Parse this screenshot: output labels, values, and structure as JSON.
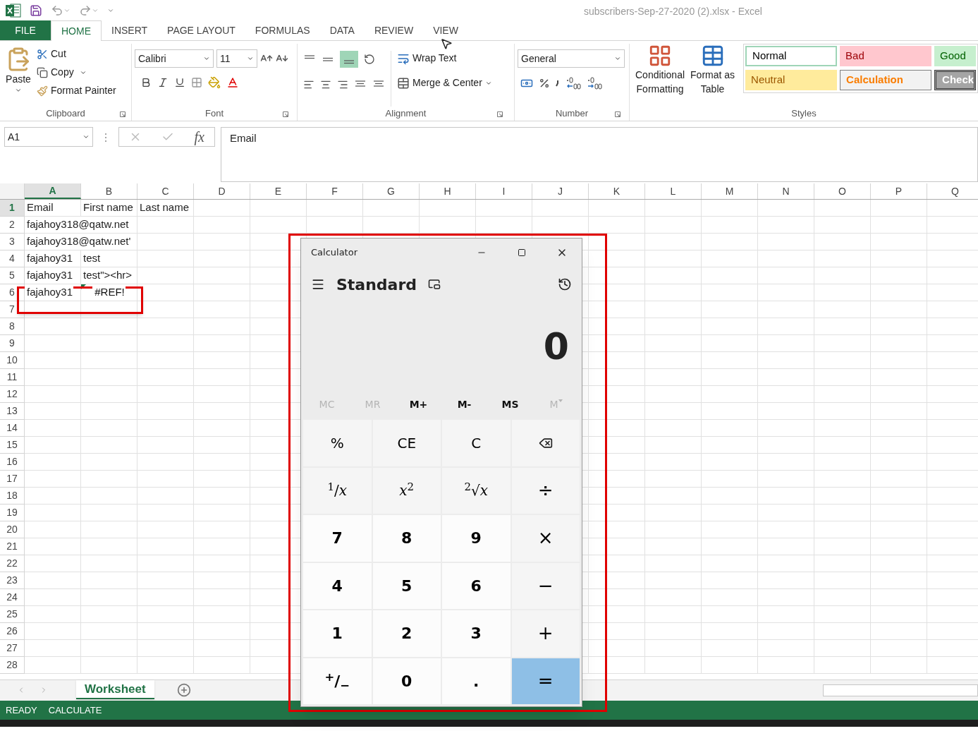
{
  "title_bar": {
    "title": "subscribers-Sep-27-2020 (2).xlsx - Excel"
  },
  "ribbon_tabs": [
    {
      "label": "FILE",
      "kind": "file",
      "selected": false
    },
    {
      "label": "HOME",
      "kind": "tab",
      "selected": true
    },
    {
      "label": "INSERT",
      "kind": "tab",
      "selected": false
    },
    {
      "label": "PAGE LAYOUT",
      "kind": "tab",
      "selected": false
    },
    {
      "label": "FORMULAS",
      "kind": "tab",
      "selected": false
    },
    {
      "label": "DATA",
      "kind": "tab",
      "selected": false
    },
    {
      "label": "REVIEW",
      "kind": "tab",
      "selected": false
    },
    {
      "label": "VIEW",
      "kind": "tab",
      "selected": false
    }
  ],
  "clipboard": {
    "paste": "Paste",
    "cut": "Cut",
    "copy": "Copy",
    "format_painter": "Format Painter",
    "label": "Clipboard"
  },
  "font": {
    "name": "Calibri",
    "size": "11",
    "label": "Font"
  },
  "alignment": {
    "wrap_text": "Wrap Text",
    "merge": "Merge & Center",
    "label": "Alignment"
  },
  "number": {
    "format": "General",
    "label": "Number"
  },
  "styles": {
    "conditional": [
      "Conditional",
      "Formatting"
    ],
    "format_table": [
      "Format as",
      "Table"
    ],
    "label": "Styles",
    "cells": [
      {
        "label": "Normal",
        "kind": "normal"
      },
      {
        "label": "Bad",
        "kind": "bad"
      },
      {
        "label": "Good",
        "kind": "good"
      },
      {
        "label": "Neutral",
        "kind": "neutral"
      },
      {
        "label": "Calculation",
        "kind": "calculation"
      },
      {
        "label": "Check",
        "kind": "check"
      }
    ]
  },
  "formula_bar": {
    "name_box": "A1",
    "fx": "fx",
    "content": "Email"
  },
  "grid": {
    "columns": [
      {
        "label": "A",
        "selected": true
      },
      {
        "label": "B",
        "selected": false
      },
      {
        "label": "C",
        "selected": false
      },
      {
        "label": "D",
        "selected": false
      },
      {
        "label": "E",
        "selected": false
      },
      {
        "label": "F",
        "selected": false
      },
      {
        "label": "G",
        "selected": false
      },
      {
        "label": "H",
        "selected": false
      },
      {
        "label": "I",
        "selected": false
      },
      {
        "label": "J",
        "selected": false
      },
      {
        "label": "K",
        "selected": false
      },
      {
        "label": "L",
        "selected": false
      },
      {
        "label": "M",
        "selected": false
      },
      {
        "label": "N",
        "selected": false
      },
      {
        "label": "O",
        "selected": false
      },
      {
        "label": "P",
        "selected": false
      },
      {
        "label": "Q",
        "selected": false
      }
    ],
    "rows": [
      {
        "number": "1",
        "selected": true,
        "cells": [
          {
            "text": "Email",
            "error": false
          },
          {
            "text": "First name",
            "error": false
          },
          {
            "text": "Last name",
            "error": false
          }
        ]
      },
      {
        "number": "2",
        "selected": false,
        "cells": [
          {
            "text": "fajahoy318@qatw.net",
            "error": false
          }
        ]
      },
      {
        "number": "3",
        "selected": false,
        "cells": [
          {
            "text": "fajahoy318@qatw.net'",
            "error": false
          }
        ]
      },
      {
        "number": "4",
        "selected": false,
        "cells": [
          {
            "text": "fajahoy31",
            "error": false
          },
          {
            "text": "test",
            "error": false
          }
        ]
      },
      {
        "number": "5",
        "selected": false,
        "cells": [
          {
            "text": "fajahoy31",
            "error": false
          },
          {
            "text": "test\"><hr>",
            "error": false
          }
        ]
      },
      {
        "number": "6",
        "selected": false,
        "cells": [
          {
            "text": "fajahoy31",
            "error": false
          },
          {
            "text": "#REF!",
            "error": true
          }
        ]
      },
      {
        "number": "7",
        "selected": false,
        "cells": []
      },
      {
        "number": "8",
        "selected": false,
        "cells": []
      },
      {
        "number": "9",
        "selected": false,
        "cells": []
      },
      {
        "number": "10",
        "selected": false,
        "cells": []
      },
      {
        "number": "11",
        "selected": false,
        "cells": []
      },
      {
        "number": "12",
        "selected": false,
        "cells": []
      },
      {
        "number": "13",
        "selected": false,
        "cells": []
      },
      {
        "number": "14",
        "selected": false,
        "cells": []
      },
      {
        "number": "15",
        "selected": false,
        "cells": []
      },
      {
        "number": "16",
        "selected": false,
        "cells": []
      },
      {
        "number": "17",
        "selected": false,
        "cells": []
      },
      {
        "number": "18",
        "selected": false,
        "cells": []
      },
      {
        "number": "19",
        "selected": false,
        "cells": []
      },
      {
        "number": "20",
        "selected": false,
        "cells": []
      },
      {
        "number": "21",
        "selected": false,
        "cells": []
      },
      {
        "number": "22",
        "selected": false,
        "cells": []
      },
      {
        "number": "23",
        "selected": false,
        "cells": []
      },
      {
        "number": "24",
        "selected": false,
        "cells": []
      },
      {
        "number": "25",
        "selected": false,
        "cells": []
      },
      {
        "number": "26",
        "selected": false,
        "cells": []
      },
      {
        "number": "27",
        "selected": false,
        "cells": []
      },
      {
        "number": "28",
        "selected": false,
        "cells": []
      }
    ]
  },
  "sheet_tabs": [
    {
      "label": "Worksheet",
      "selected": true
    }
  ],
  "status_bar": [
    "READY",
    "CALCULATE"
  ],
  "calculator": {
    "title": "Calculator",
    "mode": "Standard",
    "display": "0",
    "memory": [
      {
        "label": "MC",
        "disabled": true,
        "kind": "plain"
      },
      {
        "label": "MR",
        "disabled": true,
        "kind": "plain"
      },
      {
        "label": "M+",
        "disabled": false,
        "kind": "plain"
      },
      {
        "label": "M-",
        "disabled": false,
        "kind": "plain"
      },
      {
        "label": "MS",
        "disabled": false,
        "kind": "plain"
      },
      {
        "label": "M",
        "disabled": true,
        "kind": "dropdown"
      }
    ],
    "keys": [
      {
        "label": "%",
        "kind": "function"
      },
      {
        "label": "CE",
        "kind": "function"
      },
      {
        "label": "C",
        "kind": "function"
      },
      {
        "kind": "backspace"
      },
      {
        "label": "$^{1}$/*x*",
        "kind": "function"
      },
      {
        "label": "*x*$^{2}$",
        "kind": "function"
      },
      {
        "label": "$^{2}$√*x*",
        "kind": "function"
      },
      {
        "label": "÷",
        "kind": "operator"
      },
      {
        "label": "7",
        "kind": "digit"
      },
      {
        "label": "8",
        "kind": "digit"
      },
      {
        "label": "9",
        "kind": "digit"
      },
      {
        "label": "×",
        "kind": "operator"
      },
      {
        "label": "4",
        "kind": "digit"
      },
      {
        "label": "5",
        "kind": "digit"
      },
      {
        "label": "6",
        "kind": "digit"
      },
      {
        "label": "−",
        "kind": "operator"
      },
      {
        "label": "1",
        "kind": "digit"
      },
      {
        "label": "2",
        "kind": "digit"
      },
      {
        "label": "3",
        "kind": "digit"
      },
      {
        "label": "+",
        "kind": "operator"
      },
      {
        "label": "$^{+}$/$_{−}$",
        "kind": "digit"
      },
      {
        "label": "0",
        "kind": "digit"
      },
      {
        "label": ".",
        "kind": "digit"
      },
      {
        "label": "=",
        "kind": "equals"
      }
    ]
  }
}
